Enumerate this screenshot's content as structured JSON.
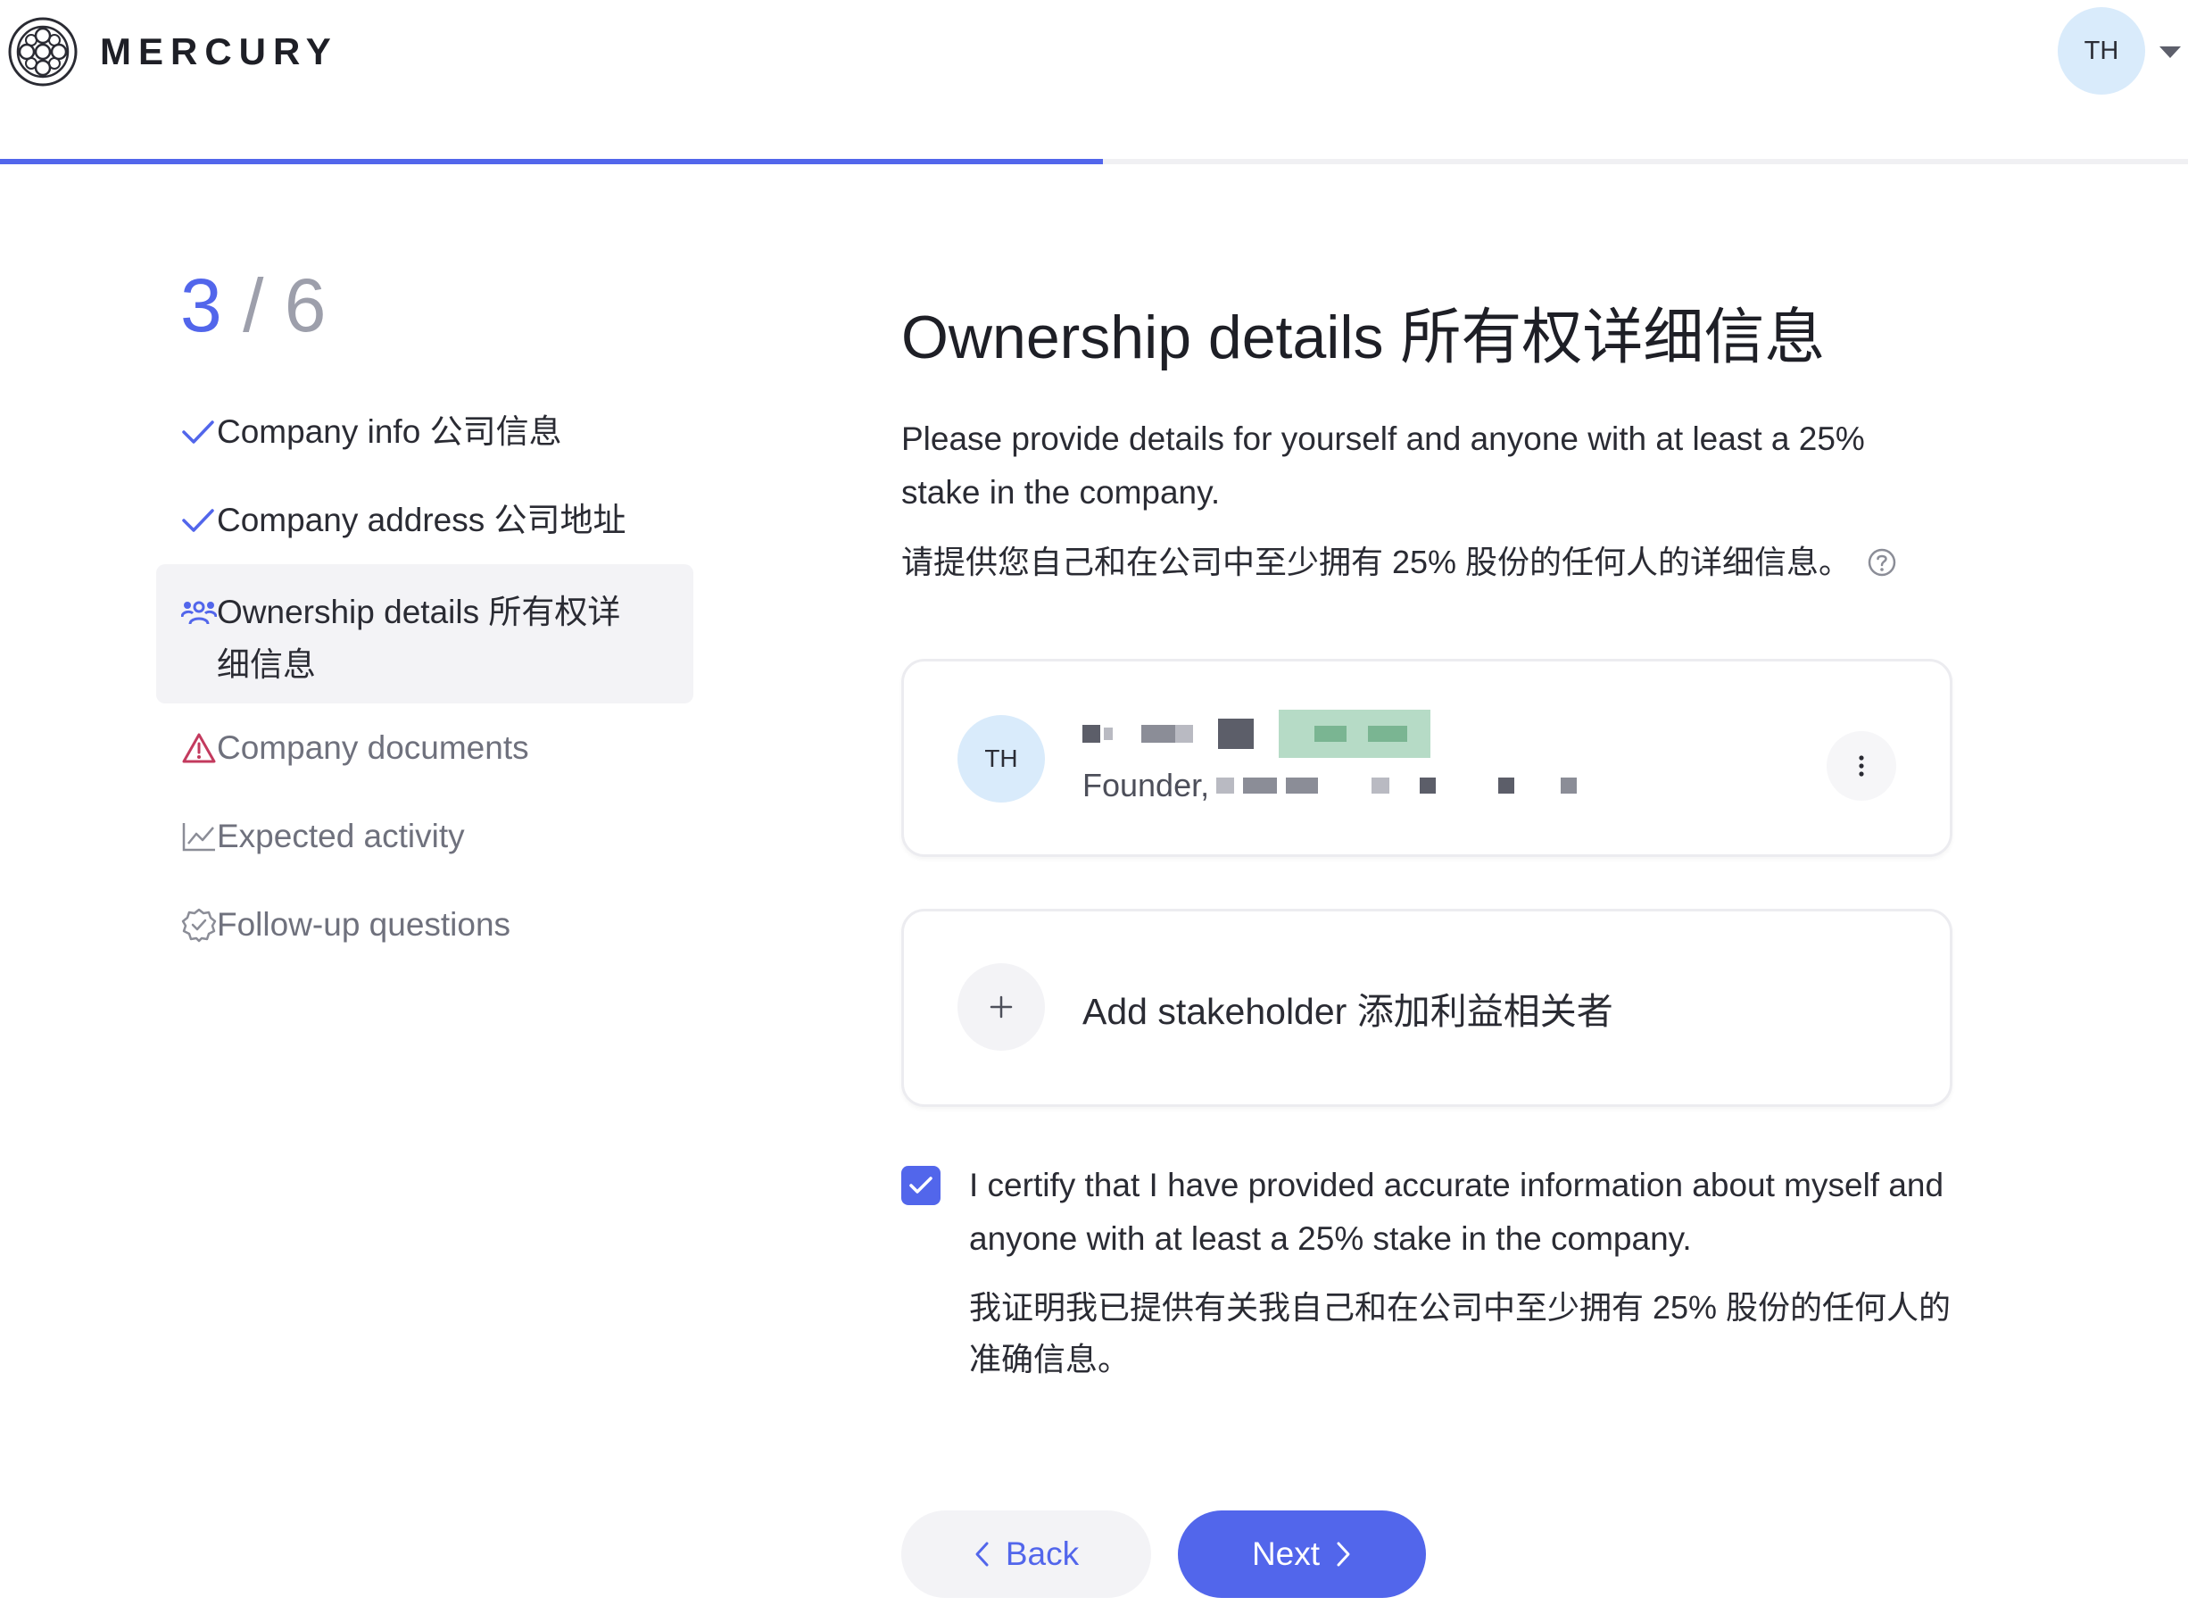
{
  "header": {
    "brand": "MERCURY",
    "user_initials": "TH",
    "progress": 0.504
  },
  "sidebar": {
    "step_current": "3",
    "step_separator": "/",
    "step_total": "6",
    "items": [
      {
        "label": "Company info 公司信息",
        "status": "done",
        "icon": "check-icon"
      },
      {
        "label": "Company address 公司地址",
        "status": "done",
        "icon": "check-icon"
      },
      {
        "label_line1": "Ownership details 所有权详",
        "label_line2": "细信息",
        "status": "active",
        "icon": "people-icon"
      },
      {
        "label": "Company documents",
        "status": "warning",
        "icon": "warning-icon"
      },
      {
        "label": "Expected activity",
        "status": "pending",
        "icon": "chart-icon"
      },
      {
        "label": "Follow-up questions",
        "status": "pending",
        "icon": "badge-check-icon"
      }
    ]
  },
  "main": {
    "title": "Ownership details 所有权详细信息",
    "description_en": "Please provide details for yourself and anyone with at least a 25% stake in the company.",
    "description_zh": "请提供您自己和在公司中至少拥有 25% 股份的任何人的详细信息。",
    "stakeholder": {
      "initials": "TH",
      "role": "Founder,"
    },
    "add_stakeholder_label": "Add stakeholder 添加利益相关者",
    "certify_checked": true,
    "certify_en": "I certify that I have provided accurate information about myself and anyone with at least a 25% stake in the company.",
    "certify_zh": "我证明我已提供有关我自己和在公司中至少拥有 25% 股份的任何人的准确信息。",
    "back_label": "Back",
    "next_label": "Next"
  },
  "colors": {
    "accent": "#5266eb",
    "warning": "#c33a5e",
    "avatar_bg": "#d9ebfb"
  }
}
